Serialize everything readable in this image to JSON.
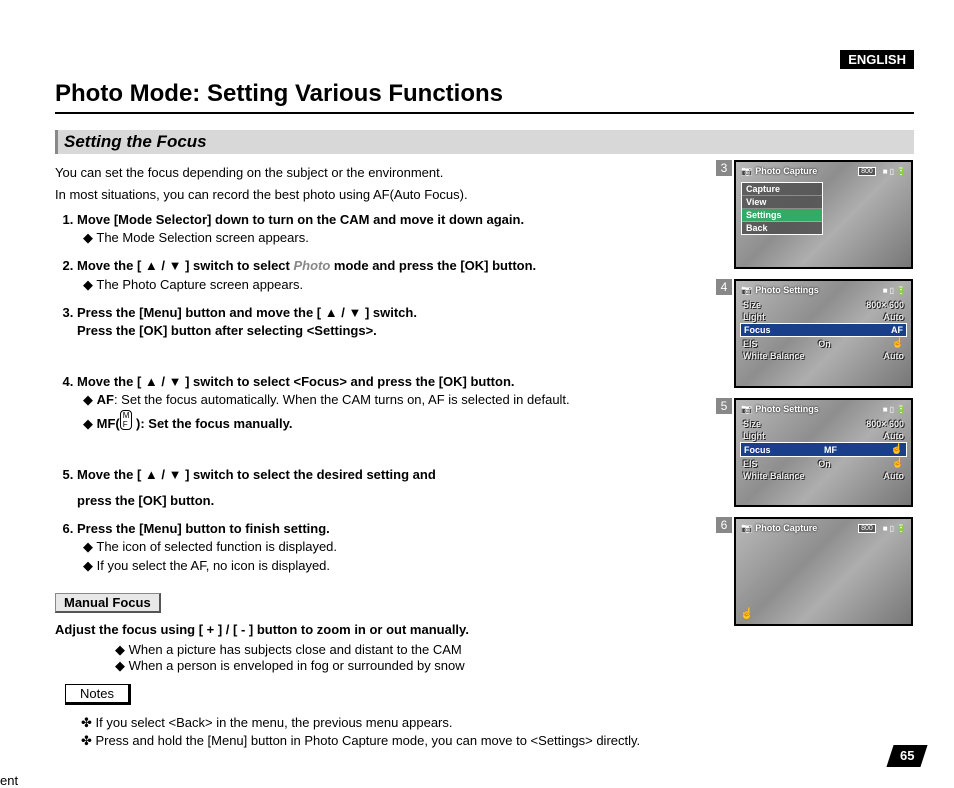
{
  "lang": "ENGLISH",
  "title": "Photo Mode: Setting Various Functions",
  "section": "Setting the Focus",
  "intro1": "You can set the focus depending on the subject or the environment.",
  "intro2": "In most situations, you can record the best photo using AF(Auto Focus).",
  "steps": {
    "s1": "Move [Mode Selector] down to turn on the CAM and move it down again.",
    "s1a": "The Mode Selection screen appears.",
    "s2a": "Move the [ ",
    "s2b": " ] switch to select ",
    "s2photo": "Photo",
    "s2c": " mode and press the [OK] button.",
    "s2d": "The Photo Capture screen appears.",
    "s3a": "Press the [Menu] button and move the [ ",
    "s3b": " ] switch.",
    "s3c": "Press the [OK] button after selecting <Settings>.",
    "s4a": "Move the [ ",
    "s4b": " ] switch to select <Focus> and press the [OK] button.",
    "s4af1": "AF",
    "s4af2": ": Set the focus automatically. When the CAM turns on, AF is selected in default.",
    "s4mf1": "MF(",
    "s4mf2": "): Set the focus manually.",
    "s5a": "Move the [ ",
    "s5b": " ] switch to select the desired setting and",
    "s5c": "press the [OK] button.",
    "s6": "Press the [Menu] button to finish setting.",
    "s6a": "The icon of selected function is displayed.",
    "s6b": "If you select the AF, no icon is displayed."
  },
  "mf_h": "Manual Focus",
  "mf_line": "Adjust the focus using [ + ] / [ - ] button to zoom in or out manually.",
  "mf_b1": "When a picture has subjects close and distant to the CAM",
  "mf_b2": "When a person is enveloped in fog or surrounded by snow",
  "notes_h": "Notes",
  "note1": "If you select <Back> in the menu, the previous menu appears.",
  "note2": "Press and hold the [Menu] button in Photo Capture mode, you can move to <Settings> directly.",
  "screens": {
    "t_capture": "Photo Capture",
    "t_settings": "Photo Settings",
    "badge": "800",
    "menu": [
      "Capture",
      "View",
      "Settings",
      "Back"
    ],
    "rows": {
      "size_l": "Size",
      "size_v": "800× 600",
      "light_l": "Light",
      "light_v": "Auto",
      "focus_l": "Focus",
      "focus_af": "AF",
      "focus_mf": "MF",
      "eis_l": "EIS",
      "eis_v": "On",
      "wb_l": "White Balance",
      "wb_v": "Auto"
    }
  },
  "page": "65"
}
